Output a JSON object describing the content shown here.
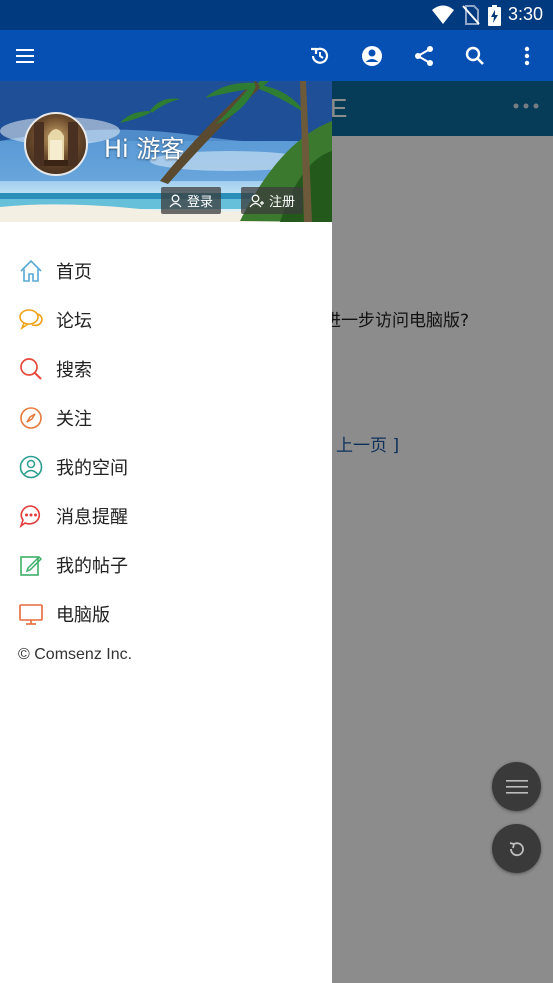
{
  "status_bar": {
    "time": "3:30"
  },
  "page": {
    "message": "进一步访问电脑版?",
    "link": "[ 上一页 ]",
    "header_letter": "E"
  },
  "drawer": {
    "greeting": "Hi 游客",
    "login_label": "登录",
    "register_label": "注册",
    "menu": [
      {
        "label": "首页",
        "icon": "home-icon",
        "color": "#5aa9d6"
      },
      {
        "label": "论坛",
        "icon": "chat-bubbles-icon",
        "color": "#f0a21a"
      },
      {
        "label": "搜索",
        "icon": "search-icon",
        "color": "#e64a3b"
      },
      {
        "label": "关注",
        "icon": "compass-icon",
        "color": "#e67a3b"
      },
      {
        "label": "我的空间",
        "icon": "user-circle-icon",
        "color": "#2a9d8f"
      },
      {
        "label": "消息提醒",
        "icon": "message-icon",
        "color": "#e23b3b"
      },
      {
        "label": "我的帖子",
        "icon": "edit-icon",
        "color": "#3fb06b"
      },
      {
        "label": "电脑版",
        "icon": "desktop-icon",
        "color": "#e66a3b"
      }
    ],
    "copyright": "© Comsenz Inc."
  },
  "colors": {
    "status_bar": "#023a80",
    "app_bar": "#0650b4",
    "page_header": "#0d6ea0",
    "fab": "#3a3a3a"
  }
}
